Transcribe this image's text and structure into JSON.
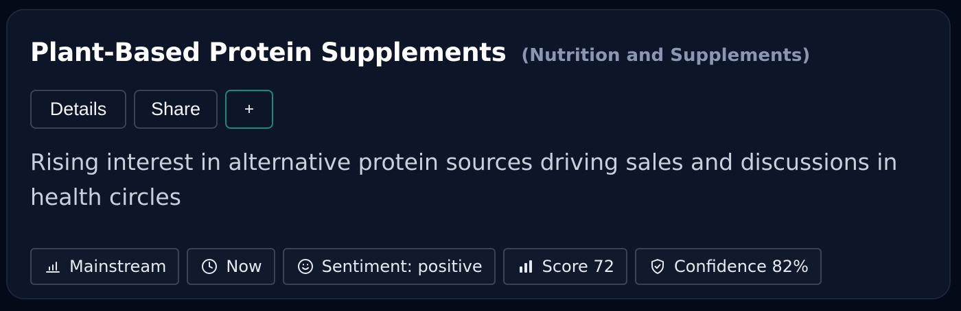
{
  "card": {
    "title": "Plant-Based Protein Supplements",
    "category": "(Nutrition and Supplements)",
    "actions": {
      "details_label": "Details",
      "share_label": "Share",
      "add_label": "+"
    },
    "description": "Rising interest in alternative protein sources driving sales and discussions in health circles",
    "tags": [
      {
        "icon": "bar-chart-outline-icon",
        "label": "Mainstream"
      },
      {
        "icon": "clock-icon",
        "label": "Now"
      },
      {
        "icon": "smile-icon",
        "label": "Sentiment: positive"
      },
      {
        "icon": "bar-chart-filled-icon",
        "label": "Score 72"
      },
      {
        "icon": "shield-check-icon",
        "label": "Confidence 82%"
      }
    ]
  },
  "colors": {
    "background": "#050a18",
    "card": "#0d1528",
    "accent_border": "#1f8a78",
    "muted_text": "#8b97b1"
  }
}
